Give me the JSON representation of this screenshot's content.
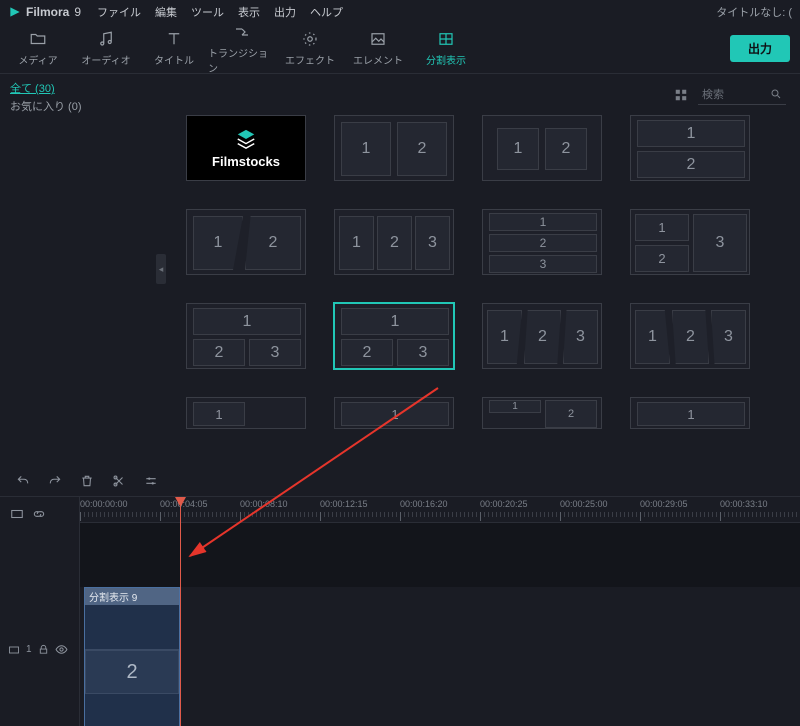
{
  "app": {
    "name": "Filmora",
    "version": "9",
    "title_status": "タイトルなし: (",
    "menu": [
      "ファイル",
      "編集",
      "ツール",
      "表示",
      "出力",
      "ヘルプ"
    ]
  },
  "tabs": {
    "items": [
      {
        "key": "media",
        "label": "メディア"
      },
      {
        "key": "audio",
        "label": "オーディオ"
      },
      {
        "key": "title",
        "label": "タイトル"
      },
      {
        "key": "transition",
        "label": "トランジション"
      },
      {
        "key": "effect",
        "label": "エフェクト"
      },
      {
        "key": "element",
        "label": "エレメント"
      },
      {
        "key": "split",
        "label": "分割表示"
      }
    ],
    "active": "split",
    "export_label": "出力"
  },
  "sidebar": {
    "all_label": "全て (30)",
    "fav_label": "お気に入り (0)"
  },
  "grid": {
    "search_placeholder": "検索",
    "presets": [
      [
        {
          "type": "filmstocks",
          "brand": "Filmstocks"
        },
        {
          "type": "cells",
          "layout": "v2",
          "labels": [
            "1",
            "2"
          ]
        },
        {
          "type": "cells",
          "layout": "v2s",
          "labels": [
            "1",
            "2"
          ]
        },
        {
          "type": "cells",
          "layout": "h2",
          "labels": [
            "1",
            "2"
          ]
        }
      ],
      [
        {
          "type": "cells",
          "layout": "v2diag",
          "labels": [
            "1",
            "2"
          ]
        },
        {
          "type": "cells",
          "layout": "v3",
          "labels": [
            "1",
            "2",
            "3"
          ]
        },
        {
          "type": "cells",
          "layout": "h3",
          "labels": [
            "1",
            "2",
            "3"
          ]
        },
        {
          "type": "cells",
          "layout": "l22r1",
          "labels": [
            "1",
            "2",
            "3"
          ]
        }
      ],
      [
        {
          "type": "cells",
          "layout": "t1b2",
          "labels": [
            "1",
            "2",
            "3"
          ],
          "selected": false
        },
        {
          "type": "cells",
          "layout": "t1b2",
          "labels": [
            "1",
            "2",
            "3"
          ],
          "selected": true
        },
        {
          "type": "cells",
          "layout": "v3diag",
          "labels": [
            "1",
            "2",
            "3"
          ]
        },
        {
          "type": "cells",
          "layout": "v3diag2",
          "labels": [
            "1",
            "2",
            "3"
          ]
        }
      ],
      [
        {
          "type": "cells",
          "layout": "partial",
          "labels": [
            "1"
          ]
        },
        {
          "type": "cells",
          "layout": "partial",
          "labels": [
            "1"
          ]
        },
        {
          "type": "cells",
          "layout": "partial3",
          "labels": [
            "1",
            "2"
          ]
        },
        {
          "type": "cells",
          "layout": "partial",
          "labels": [
            "1"
          ]
        }
      ]
    ]
  },
  "timeline": {
    "times": [
      "00:00:00:00",
      "00:00:04:05",
      "00:00:08:10",
      "00:00:12:15",
      "00:00:16:20",
      "00:00:20:25",
      "00:00:25:00",
      "00:00:29:05",
      "00:00:33:10"
    ],
    "track_label": "1",
    "clip": {
      "title": "分割表示 9",
      "visible_segment": "2"
    }
  }
}
